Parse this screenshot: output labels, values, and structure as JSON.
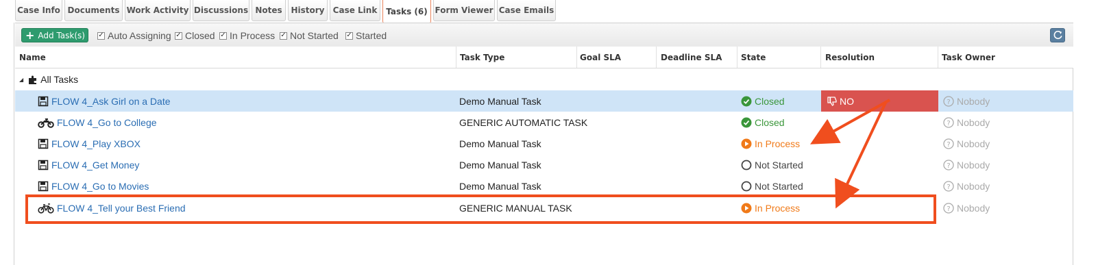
{
  "tabs": [
    {
      "label": "Case Info"
    },
    {
      "label": "Documents"
    },
    {
      "label": "Work Activity"
    },
    {
      "label": "Discussions"
    },
    {
      "label": "Notes"
    },
    {
      "label": "History"
    },
    {
      "label": "Case Link"
    },
    {
      "label": "Tasks (6)",
      "active": true
    },
    {
      "label": "Form Viewer"
    },
    {
      "label": "Case Emails"
    }
  ],
  "toolbar": {
    "add_label": "Add Task(s)",
    "filters": [
      {
        "label": "Auto Assigning",
        "checked": true
      },
      {
        "label": "Closed",
        "checked": true
      },
      {
        "label": "In Process",
        "checked": true
      },
      {
        "label": "Not Started",
        "checked": true
      },
      {
        "label": "Started",
        "checked": true
      }
    ]
  },
  "columns": [
    "Name",
    "Task Type",
    "Goal SLA",
    "Deadline SLA",
    "State",
    "Resolution",
    "Task Owner"
  ],
  "group_label": "All Tasks",
  "tasks": [
    {
      "name": "FLOW 4_Ask Girl on a Date",
      "icon": "save-icon",
      "type": "Demo Manual Task",
      "state": "Closed",
      "resolution": "NO",
      "owner": "Nobody"
    },
    {
      "name": "FLOW 4_Go to College",
      "icon": "motorcycle-icon",
      "type": "GENERIC AUTOMATIC TASK",
      "state": "Closed",
      "resolution": "",
      "owner": "Nobody"
    },
    {
      "name": "FLOW 4_Play XBOX",
      "icon": "save-icon",
      "type": "Demo Manual Task",
      "state": "In Process",
      "resolution": "",
      "owner": "Nobody"
    },
    {
      "name": "FLOW 4_Get Money",
      "icon": "save-icon",
      "type": "Demo Manual Task",
      "state": "Not Started",
      "resolution": "",
      "owner": "Nobody"
    },
    {
      "name": "FLOW 4_Go to Movies",
      "icon": "save-icon",
      "type": "Demo Manual Task",
      "state": "Not Started",
      "resolution": "",
      "owner": "Nobody"
    },
    {
      "name": "FLOW 4_Tell your Best Friend",
      "icon": "bicycle-icon",
      "type": "GENERIC MANUAL TASK",
      "state": "In Process",
      "resolution": "",
      "owner": "Nobody"
    }
  ],
  "colors": {
    "accent_green": "#2e9b6e",
    "closed": "#3a963a",
    "in_process": "#f07a19",
    "resolution_no": "#d9534f",
    "annotation": "#f04e1e",
    "link": "#2a6db3"
  }
}
